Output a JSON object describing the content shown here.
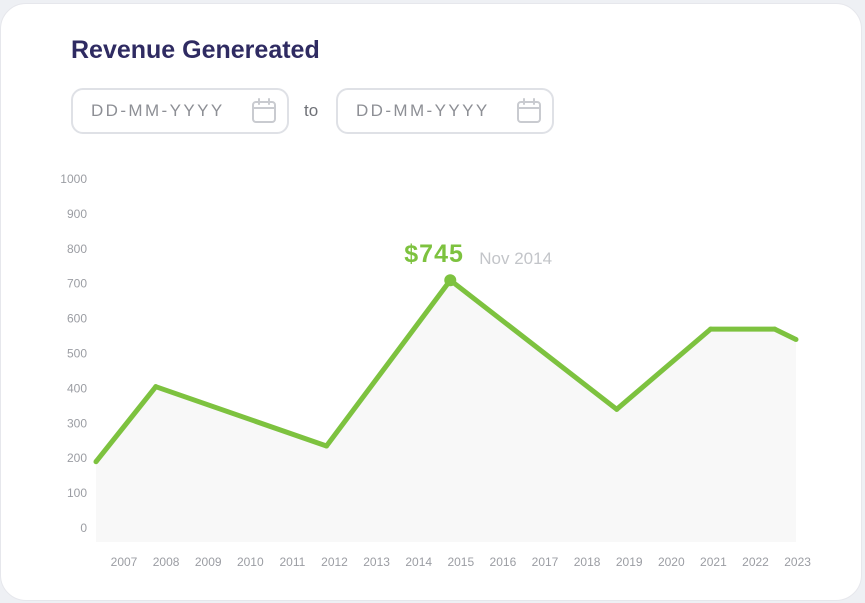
{
  "title": "Revenue Genereated",
  "date_range": {
    "from_placeholder": "DD-MM-YYYY",
    "separator": "to",
    "to_placeholder": "DD-MM-YYYY"
  },
  "colors": {
    "line": "#7dc23f",
    "area": "#f8f8f8",
    "title": "#2f2b62"
  },
  "icons": {
    "from_icon": "calendar-icon",
    "to_icon": "calendar-icon"
  },
  "chart_data": {
    "type": "line",
    "title": "Revenue Genereated",
    "xlabel": "",
    "ylabel": "",
    "x_ticks": [
      "2007",
      "2008",
      "2009",
      "2010",
      "2011",
      "2012",
      "2013",
      "2014",
      "2015",
      "2016",
      "2017",
      "2018",
      "2019",
      "2020",
      "2021",
      "2022",
      "2023"
    ],
    "y_ticks": [
      0,
      100,
      200,
      300,
      400,
      500,
      600,
      700,
      800,
      900,
      1000
    ],
    "ylim": [
      0,
      1000
    ],
    "grid": false,
    "series": [
      {
        "x": [
          2006.6,
          2008,
          2012,
          2014.9,
          2018.8,
          2021,
          2022.5,
          2023
        ],
        "y": [
          190,
          405,
          235,
          710,
          340,
          570,
          570,
          540
        ]
      }
    ],
    "annotation": {
      "value_label": "$745",
      "date_label": "Nov 2014",
      "x": 2014.9,
      "y": 710
    }
  }
}
